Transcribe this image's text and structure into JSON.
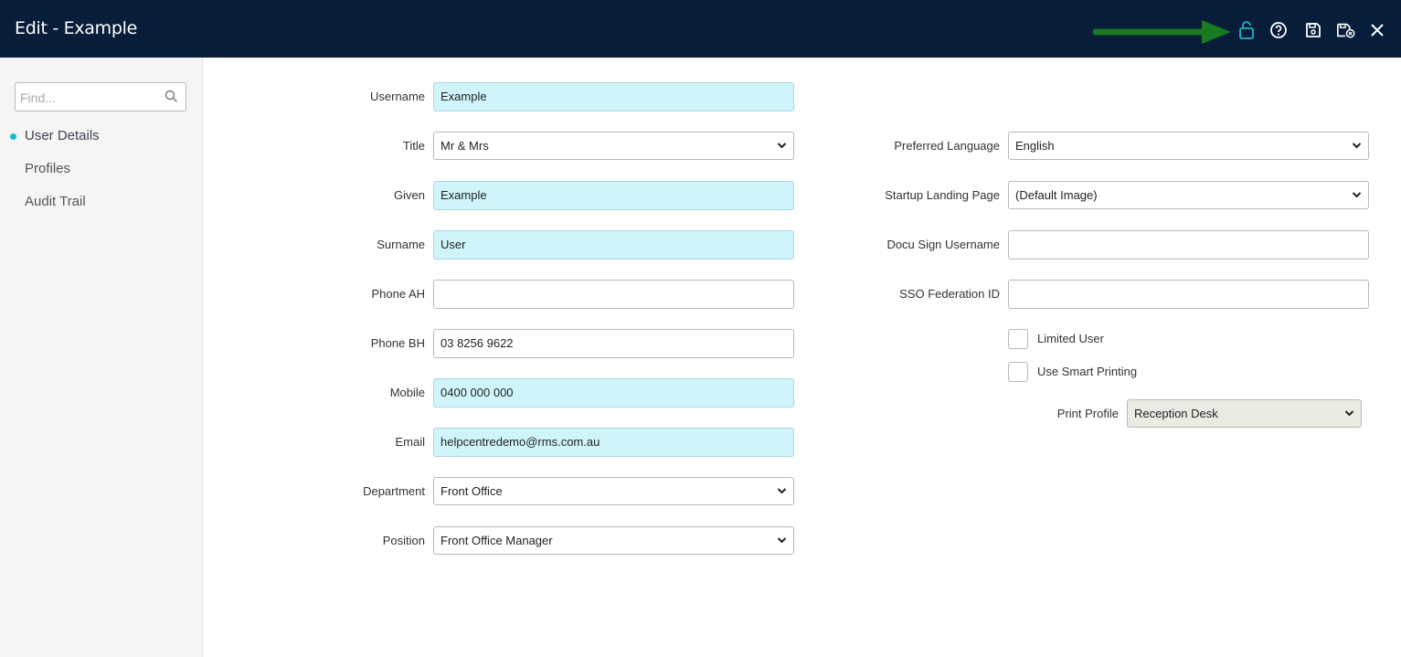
{
  "header": {
    "title": "Edit - Example",
    "icons": [
      "lock-icon",
      "help-icon",
      "save-icon",
      "save-close-icon",
      "close-icon"
    ],
    "accent_color": "#1fb6c8",
    "arrow_color": "#1a7a22"
  },
  "sidebar": {
    "search_placeholder": "Find...",
    "items": [
      {
        "label": "User Details",
        "active": true
      },
      {
        "label": "Profiles",
        "active": false
      },
      {
        "label": "Audit Trail",
        "active": false
      }
    ]
  },
  "form": {
    "username": {
      "label": "Username",
      "value": "Example"
    },
    "title": {
      "label": "Title",
      "value": "Mr & Mrs"
    },
    "given": {
      "label": "Given",
      "value": "Example"
    },
    "surname": {
      "label": "Surname",
      "value": "User"
    },
    "phone_ah": {
      "label": "Phone AH",
      "value": ""
    },
    "phone_bh": {
      "label": "Phone BH",
      "value": "03 8256 9622"
    },
    "mobile": {
      "label": "Mobile",
      "value": "0400 000 000"
    },
    "email": {
      "label": "Email",
      "value": "helpcentredemo@rms.com.au"
    },
    "department": {
      "label": "Department",
      "value": "Front Office"
    },
    "position": {
      "label": "Position",
      "value": "Front Office Manager"
    },
    "preferred_language": {
      "label": "Preferred Language",
      "value": "English"
    },
    "startup_landing_page": {
      "label": "Startup Landing Page",
      "value": "(Default Image)"
    },
    "docu_sign_username": {
      "label": "Docu Sign Username",
      "value": ""
    },
    "sso_federation_id": {
      "label": "SSO Federation ID",
      "value": ""
    },
    "limited_user": {
      "label": "Limited User",
      "checked": false
    },
    "use_smart_printing": {
      "label": "Use Smart Printing",
      "checked": false
    },
    "print_profile": {
      "label": "Print Profile",
      "value": "Reception Desk"
    }
  }
}
